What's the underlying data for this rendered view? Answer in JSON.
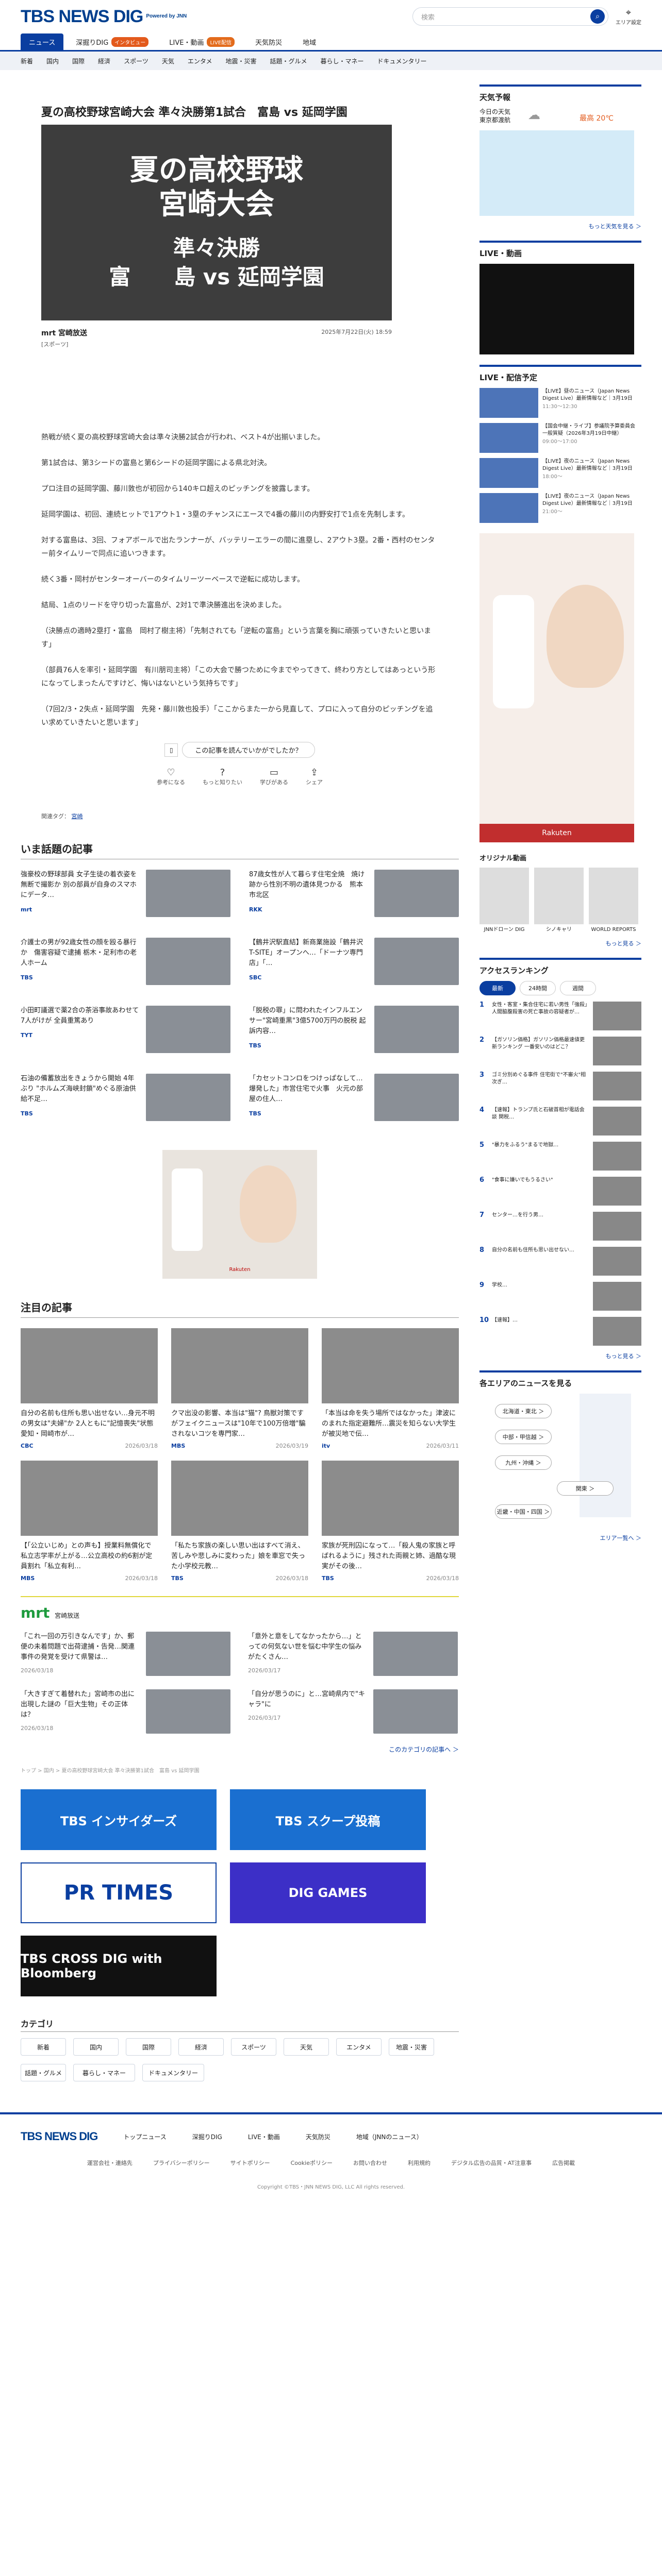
{
  "header": {
    "logo": "TBS NEWS DIG",
    "powered": "Powered by JNN",
    "search_placeholder": "検索",
    "area_label": "エリア設定"
  },
  "tabs": [
    {
      "label": "ニュース",
      "on": true
    },
    {
      "label": "深掘りDIG",
      "badge": "インタビュー",
      "badge_color": "#e35a1c"
    },
    {
      "label": "LIVE・動画",
      "badge": "LIVE配信",
      "badge_color": "#e36b1c"
    },
    {
      "label": "天気防災"
    },
    {
      "label": "地域"
    }
  ],
  "cats": [
    "新着",
    "国内",
    "国際",
    "経済",
    "スポーツ",
    "天気",
    "エンタメ",
    "地震・災害",
    "話題・グルメ",
    "暮らし・マネー",
    "ドキュメンタリー"
  ],
  "article": {
    "title": "夏の高校野球宮崎大会 準々決勝第1試合　富島 vs 延岡学園",
    "hero_l1": "夏の高校野球",
    "hero_l2": "宮崎大会",
    "hero_l3": "準々決勝",
    "hero_l4": "富　　島 vs 延岡学園",
    "source": "mrt 宮崎放送",
    "date": "2025年7月22日(火) 18:59",
    "tag": "[スポーツ]",
    "paras": [
      "熱戦が続く夏の高校野球宮崎大会は準々決勝2試合が行われ、ベスト4が出揃いました。",
      "第1試合は、第3シードの富島と第6シードの延岡学園による県北対決。",
      "プロ注目の延岡学園、藤川敦也が初回から140キロ超えのピッチングを披露します。",
      "延岡学園は、初回、連続ヒットで1アウト1・3塁のチャンスにエースで4番の藤川の内野安打で1点を先制します。",
      "対する富島は、3回、フォアボールで出たランナーが、バッテリーエラーの間に進塁し、2アウト3塁。2番・西村のセンター前タイムリーで同点に追いつきます。",
      "続く3番・岡村がセンターオーバーのタイムリーツーベースで逆転に成功します。",
      "結局、1点のリードを守り切った富島が、2対1で準決勝進出を決めました。",
      "（決勝点の適時2塁打・富島　岡村了樹主将）「先制されても「逆転の富島」という言葉を胸に頑張っていきたいと思います」",
      "（部員76人を率引・延岡学園　有川朋司主将）「この大会で勝つために今までやってきて、終わり方としてはあっという形になってしまったんですけど、悔いはないという気持ちです」",
      "（7回2/3・2失点・延岡学園　先発・藤川敦也投手）「ここからまた一から見直して、プロに入って自分のピッチングを追い求めていきたいと思います」"
    ],
    "feedback_q": "この記事を読んでいかがでしたか？",
    "reactions": [
      "参考になる",
      "もっと知りたい",
      "学びがある",
      "シェア"
    ],
    "related_label": "関連タグ：",
    "related_tag": "宮崎"
  },
  "trend": {
    "title": "いま話題の記事",
    "items": [
      {
        "t": "強豪校の野球部員 女子生徒の着衣姿を無断で撮影か 別の部員が自身のスマホにデータ…",
        "s": "mrt"
      },
      {
        "t": "87歳女性が人て暮らす住宅全焼　焼け跡から性別不明の遺体見つかる　熊本市北区",
        "s": "RKK"
      },
      {
        "t": "介護士の男が92歳女性の顔を殴る暴行か　傷害容疑で逮捕 栃木・足利市の老人ホーム",
        "s": "TBS"
      },
      {
        "t": "【鶴井沢駅直結】新商業施設「鶴井沢T-SITE」オープンへ…「ドーナツ専門店」「…",
        "s": "SBC"
      },
      {
        "t": "小田町議選で薬2合の茶浴事故あわせて7人がけが 全員重篤あり",
        "s": "TYT"
      },
      {
        "t": "「脱税の罪」に問われたインフルエンサー\"宮崎重黒\"3億5700万円の脱税 起訴内容…",
        "s": "TBS"
      },
      {
        "t": "石油の備蓄放出をきょうから開始 4年ぶり \"ホルムズ海峡封鎖\"めぐる原油供給不足…",
        "s": "TBS"
      },
      {
        "t": "「カセットコンロをつけっぱなして…爆発した」市営住宅で火事　火元の部屋の住人…",
        "s": "TBS"
      }
    ]
  },
  "attention": {
    "title": "注目の記事",
    "items": [
      {
        "t": "自分の名前も住所も思い出せない…身元不明の男女は\"夫婦\"か 2人ともに\"記憶喪失\"状態 愛知・岡崎市が…",
        "s": "CBC",
        "d": "2026/03/18"
      },
      {
        "t": "クマ出没の影響、本当は\"猫\"? 鳥獣対策ですがフェイクニュースは\"10年で100万倍増\"騙されないコツを専門家…",
        "s": "MBS",
        "d": "2026/03/19"
      },
      {
        "t": "「本当は命を失う場所ではなかった」津波にのまれた指定避難所…震災を知らない大学生が被災地で伝…",
        "s": "itv",
        "d": "2026/03/11"
      },
      {
        "t": "【「公立いじめ」との声も】授業料無償化で私立志学率が上がる…公立高校の約6割が定員割れ「私立有利…",
        "s": "MBS",
        "d": "2026/03/18"
      },
      {
        "t": "「私たち家族の楽しい思い出はすべて消え、苦しみや悲しみに変わった」娘を車窓で失った小学校元教…",
        "s": "TBS",
        "d": "2026/03/18"
      },
      {
        "t": "家族が死刑囚になって…「殺人鬼の家族と呼ばれるように」残された両親と姉、過酷な現実がその後…",
        "s": "TBS",
        "d": "2026/03/18"
      }
    ]
  },
  "mrt": {
    "logo": "mrt",
    "sub": "宮崎放送",
    "items": [
      {
        "t": "「これ一回の万引きなんです」か、郵便の未着問題で出荷逮捕・告発…関連事件の発覚を受けて県警は…",
        "d": "2026/03/18"
      },
      {
        "t": "「意外と意をしてなかったから…」とっての何気ない世を悩む中学生の悩みがたくさん…",
        "d": "2026/03/17"
      },
      {
        "t": "「大きすぎて着替れた」宮崎市の出に出現した謎の「巨大生物」その正体は？",
        "d": "2026/03/18"
      },
      {
        "t": "「自分が思うのに」と…宮崎県内で\"キャラ\"に",
        "d": "2026/03/17"
      }
    ],
    "more": "このカテゴリの記事へ ＞"
  },
  "breadcrumb": "トップ > 国内 > 夏の高校野球宮崎大会 準々決勝第1試合　富島 vs 延岡学園",
  "banners": [
    {
      "t": "TBS インサイダーズ",
      "bg": "#1a6fd0"
    },
    {
      "t": "TBS スクープ投稿",
      "bg": "#1a6fd0"
    },
    {
      "t": "PR TIMES",
      "bg": "#ffffff"
    },
    {
      "t": "DIG GAMES",
      "bg": "#3c2fc7"
    },
    {
      "t": "TBS CROSS DIG with Bloomberg",
      "bg": "#111111"
    }
  ],
  "category": {
    "title": "カテゴリ",
    "items": [
      "新着",
      "国内",
      "国際",
      "経済",
      "スポーツ",
      "天気",
      "エンタメ",
      "地震・災害",
      "話題・グルメ",
      "暮らし・マネー",
      "ドキュメンタリー"
    ]
  },
  "side": {
    "weather_title": "天気予報",
    "weather_loc1": "今日の天気",
    "weather_loc2": "東京都渡航",
    "weather_temp": "最高 20℃",
    "weather_more": "もっと天気を見る ＞",
    "live_title": "LIVE・動画",
    "live_more": "もっと見る ＞",
    "sched_title": "LIVE・配信予定",
    "sched": [
      {
        "t": "【LIVE】昼のニュース（Japan News Digest Live）最新情報など｜3月19日",
        "tm": "11:30〜12:30"
      },
      {
        "t": "【国会中継・ライブ】参議院予算委員会　一般質疑（2026年3月19日中継）",
        "tm": "09:00〜17:00"
      },
      {
        "t": "【LIVE】夜のニュース（Japan News Digest Live）最新情報など｜3月19日",
        "tm": "18:00〜"
      },
      {
        "t": "【LIVE】夜のニュース（Japan News Digest Live）最新情報など｜3月19日",
        "tm": "21:00〜"
      }
    ],
    "ad_label": "Rakuten",
    "orig_title": "オリジナル動画",
    "orig": [
      "JNNドローン DIG",
      "シノキャリ",
      "WORLD REPORTS"
    ],
    "orig_more": "もっと見る ＞",
    "rank_title": "アクセスランキング",
    "rank_tabs": [
      "最新",
      "24時間",
      "週間"
    ],
    "rank": [
      "女性・客室・集合住宅に若い男性「強殺」人間脇腹殺害の死亡事故の容疑者が…",
      "【ガソリン価格】ガソリン価格最速値更新ランキング 一番安いのはどこ？",
      "ゴミ分別めぐる事件 住宅街で\"不審火\"相次ぎ…",
      "【速報】トランプ氏と石破首相が電話会談 関税…",
      "\"暴力をふるう\"まるで地獄…",
      "\"食事に嫌いでもうるさい\"",
      "センター…を行う男…",
      "自分の名前も住所も思い出せない…",
      "学校…",
      "【速報】…"
    ],
    "rank_more": "もっと見る ＞",
    "area_title": "各エリアのニュースを見る",
    "areas": [
      "北海道・東北 ＞",
      "中部・甲信越 ＞",
      "九州・沖縄 ＞",
      "関東 ＞",
      "近畿・中国・四国 ＞"
    ],
    "area_more": "エリア一覧へ ＞"
  },
  "footer": {
    "logo": "TBS NEWS DIG",
    "links1": [
      "トップニュース",
      "深掘りDIG",
      "LIVE・動画",
      "天気防災",
      "地域（JNNのニュース）"
    ],
    "links2": [
      "運営会社・連絡先",
      "プライバシーポリシー",
      "サイトポリシー",
      "Cookieポリシー",
      "お問い合わせ",
      "利用規約",
      "デジタル広告の品質・AT注意事",
      "広告掲載"
    ],
    "copy": "Copyright ©TBS・JNN NEWS DIG, LLC All rights reserved."
  }
}
